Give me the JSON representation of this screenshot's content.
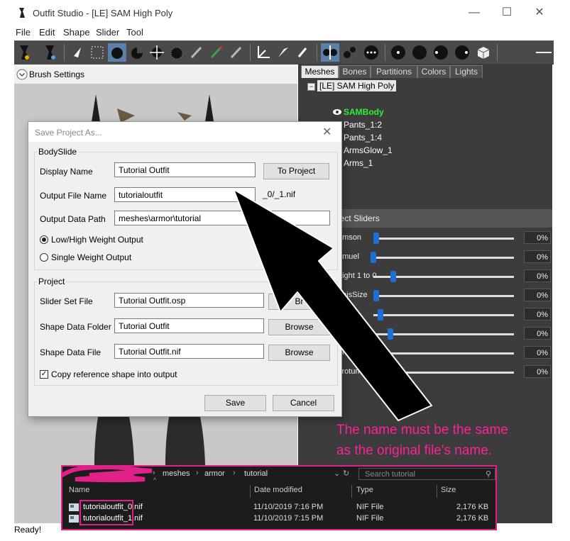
{
  "window": {
    "title": "Outfit Studio - [LE] SAM High Poly",
    "minimize": "—",
    "maximize": "☐",
    "close": "✕"
  },
  "menu": [
    "File",
    "Edit",
    "Shape",
    "Slider",
    "Tool"
  ],
  "toolbar_icons": [
    "brush-select-icon",
    "brush-inflate-icon",
    "select-tool-icon",
    "mask-tool-icon",
    "inflate-tool-icon",
    "deflate-tool-icon",
    "move-tool-icon",
    "smooth-tool-icon",
    "undiff-tool-icon",
    "weight-tool-icon",
    "color-tool-icon",
    "alpha-tool-icon",
    "transform-tool-icon",
    "pivot-tool-icon",
    "vertex-edit-icon",
    "mirror-x-icon",
    "show-vertices-icon",
    "show-mask-icon",
    "view-front-icon",
    "view-back-icon",
    "view-left-icon",
    "view-right-icon",
    "perspective-icon"
  ],
  "left_panel": {
    "brush_settings": "Brush Settings"
  },
  "right_panel": {
    "tabs": [
      "Meshes",
      "Bones",
      "Partitions",
      "Colors",
      "Lights"
    ],
    "active_tab": "Meshes",
    "tree": {
      "root": "[LE] SAM High Poly",
      "items": [
        {
          "label": "SAMBody",
          "color": "#33ee33"
        },
        {
          "label": "Pants_1:2",
          "color": "#ffffff"
        },
        {
          "label": "Pants_1:4",
          "color": "#ffffff"
        },
        {
          "label": "ArmsGlow_1",
          "color": "#ffffff"
        },
        {
          "label": "Arms_1",
          "color": "#ffffff"
        }
      ]
    },
    "sliders_header": "lect Sliders",
    "sliders": [
      {
        "name": "amson",
        "value": "0%",
        "level": 0.0
      },
      {
        "name": "amuel",
        "value": "0%",
        "level": 0.0
      },
      {
        "name": "eight 1 to 0",
        "value": "0%",
        "level": 0.0
      },
      {
        "name": "enisSize",
        "value": "0%",
        "level": 0.0
      },
      {
        "name": "aper",
        "value": "0%",
        "level": 0.0
      },
      {
        "name": "de",
        "value": "0%",
        "level": 0.0
      },
      {
        "name": "eni",
        "value": "0%",
        "level": 0.0
      },
      {
        "name": "crotum",
        "value": "0%",
        "level": 0.0
      }
    ]
  },
  "dialog": {
    "title": "Save Project As...",
    "close": "✕",
    "bodyslide": {
      "group_label": "BodySlide",
      "display_name_label": "Display Name",
      "display_name_value": "Tutorial Outfit",
      "to_project": "To Project",
      "output_file_label": "Output File Name",
      "output_file_value": "tutorialoutfit",
      "output_suffix": "_0/_1.nif",
      "output_path_label": "Output Data Path",
      "output_path_value": "meshes\\armor\\tutorial",
      "radio_low_high": "Low/High Weight Output",
      "radio_single": "Single Weight Output",
      "selected": "low_high"
    },
    "project": {
      "group_label": "Project",
      "slider_set_label": "Slider Set File",
      "slider_set_value": "Tutorial Outfit.osp",
      "slider_set_button": "Br",
      "shape_folder_label": "Shape Data Folder",
      "shape_folder_value": "Tutorial Outfit",
      "shape_folder_button": "Browse",
      "shape_file_label": "Shape Data File",
      "shape_file_value": "Tutorial Outfit.nif",
      "shape_file_button": "Browse",
      "copy_ref_label": "Copy reference shape into output",
      "copy_ref_checked": true
    },
    "save": "Save",
    "cancel": "Cancel"
  },
  "annotation": {
    "line1": "The name must be the same",
    "line2": "as the original file's name.",
    "color": "#ff1f9a"
  },
  "explorer": {
    "path": [
      "meshes",
      "armor",
      "tutorial"
    ],
    "search_placeholder": "Search tutorial",
    "columns": [
      "Name",
      "Date modified",
      "Type",
      "Size"
    ],
    "files": [
      {
        "name": "tutorialoutfit_0.nif",
        "date": "11/10/2019 7:16 PM",
        "type": "NIF File",
        "size": "2,176 KB"
      },
      {
        "name": "tutorialoutfit_1.nif",
        "date": "11/10/2019 7:15 PM",
        "type": "NIF File",
        "size": "2,176 KB"
      }
    ]
  },
  "status": "Ready!"
}
